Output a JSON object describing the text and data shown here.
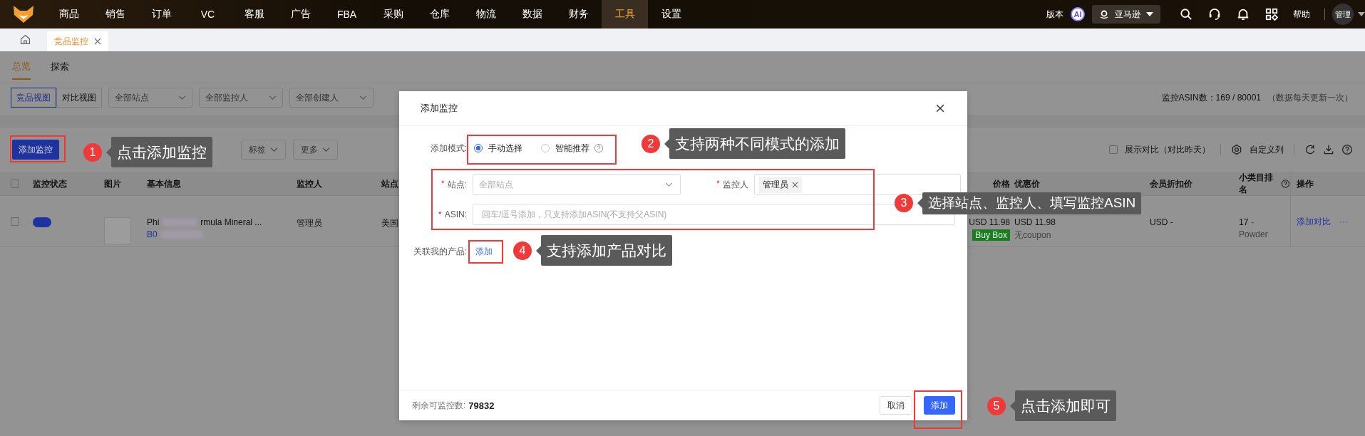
{
  "nav": {
    "items": [
      {
        "label": "商品",
        "selected": false
      },
      {
        "label": "销售",
        "selected": false
      },
      {
        "label": "订单",
        "selected": false
      },
      {
        "label": "VC",
        "selected": false
      },
      {
        "label": "客服",
        "selected": false
      },
      {
        "label": "广告",
        "selected": false
      },
      {
        "label": "FBA",
        "selected": false
      },
      {
        "label": "采购",
        "selected": false
      },
      {
        "label": "仓库",
        "selected": false
      },
      {
        "label": "物流",
        "selected": false
      },
      {
        "label": "数据",
        "selected": false
      },
      {
        "label": "财务",
        "selected": false
      },
      {
        "label": "工具",
        "selected": true
      },
      {
        "label": "设置",
        "selected": false
      }
    ],
    "version": "版本",
    "ai": "AI",
    "store": "亚马逊",
    "help": "帮助",
    "user": "管理"
  },
  "tabs": [
    {
      "label": "竞品监控",
      "selected": true
    }
  ],
  "page": {
    "subtabs": [
      {
        "label": "总览",
        "selected": true
      },
      {
        "label": "探索",
        "selected": false
      }
    ],
    "views": [
      {
        "label": "竞品视图",
        "selected": true
      },
      {
        "label": "对比视图",
        "selected": false
      }
    ],
    "filters": [
      "全部站点",
      "全部监控人",
      "全部创建人"
    ],
    "asin_count": "监控ASIN数：169 / 80001",
    "update_note": "（数据每天更新一次）",
    "toolbar": {
      "add_button": "添加监控",
      "dropdowns": [
        "标签",
        "更多"
      ],
      "compare": {
        "label": "展示对比（对比昨天）",
        "checked": false
      },
      "columns_button": "自定义列"
    },
    "table": {
      "all_checked": false,
      "left_columns": [
        "监控状态",
        "图片",
        "基本信息",
        "监控人",
        "站点"
      ],
      "right_columns": [
        "价格",
        "优惠价",
        "会员折扣价",
        "小类目排名",
        "操作"
      ],
      "row": {
        "checked": false,
        "monitoring": true,
        "title_start": "Phi",
        "title_end": "rmula Mineral ...",
        "asin_start": "B0",
        "owner": "管理员",
        "site": "美国",
        "price": "USD 11.98",
        "buy_box": "Buy Box",
        "deal_price": "USD 11.98",
        "coupon": "无coupon",
        "member_price": "USD -",
        "rank": "17",
        "rank_suffix": "-",
        "category": "Powder",
        "action": "添加对比",
        "more": "···"
      }
    }
  },
  "dialog": {
    "title": "添加监控",
    "mode_label": "添加模式:",
    "modes": [
      {
        "label": "手动选择",
        "selected": true,
        "help": false
      },
      {
        "label": "智能推荐",
        "selected": false,
        "help": true
      }
    ],
    "site_label": "站点:",
    "site_placeholder": "全部站点",
    "owner_label": "监控人",
    "owner_tags": [
      "管理员"
    ],
    "asin_label": "ASIN:",
    "asin_placeholder": "回车/逗号添加，只支持添加ASIN(不支持父ASIN)",
    "related_label": "关联我的产品:",
    "related_link": "添加",
    "remaining_label": "剩余可监控数:",
    "remaining_value": "79832",
    "cancel": "取消",
    "confirm": "添加"
  },
  "annotations": [
    {
      "number": "1",
      "text": "点击添加监控"
    },
    {
      "number": "2",
      "text": "支持两种不同模式的添加"
    },
    {
      "number": "3",
      "text": "选择站点、监控人、填写监控ASIN"
    },
    {
      "number": "4",
      "text": "支持添加产品对比"
    },
    {
      "number": "5",
      "text": "点击添加即可"
    }
  ]
}
